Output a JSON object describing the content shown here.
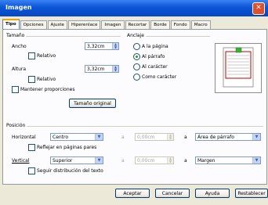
{
  "title": "Imagen",
  "tabs": [
    "Tipo",
    "Opciones",
    "Ajuste",
    "Hiperenlace",
    "Imagen",
    "Recortar",
    "Borde",
    "Fondo",
    "Macro"
  ],
  "size": {
    "title": "Tamaño",
    "width_label": "Ancho",
    "width_value": "3,32cm",
    "relative1": "Relativo",
    "height_label": "Altura",
    "height_value": "3,32cm",
    "relative2": "Relativo",
    "keep_ratio": "Mantener proporciones",
    "original_size": "Tamaño original"
  },
  "anchor": {
    "title": "Anclaje",
    "options": [
      "A la página",
      "Al párrafo",
      "Al carácter",
      "Como carácter"
    ],
    "selected_index": 1
  },
  "position": {
    "title": "Posición",
    "horizontal_label": "Horizontal",
    "horizontal_value": "Centro",
    "horizontal_by": "a",
    "horizontal_offset": "0,00cm",
    "horizontal_to": "a",
    "horizontal_ref": "Área de párrafo",
    "mirror": "Reflejar en páginas pares",
    "vertical_label": "Vertical",
    "vertical_value": "Superior",
    "vertical_by": "a",
    "vertical_offset": "0,00cm",
    "vertical_to": "a",
    "vertical_ref": "Margen",
    "follow_text": "Seguir distribución del texto"
  },
  "buttons": {
    "ok": "Aceptar",
    "cancel": "Cancelar",
    "help": "Ayuda",
    "reset": "Restablecer"
  }
}
